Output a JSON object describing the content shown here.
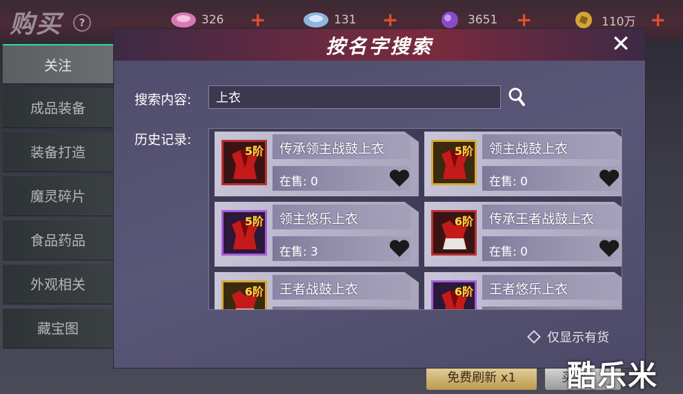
{
  "topbar": {
    "title": "购买",
    "help_glyph": "?",
    "currencies": [
      {
        "icon": "pink-gem-icon",
        "value": "326",
        "color": "#d77ab4"
      },
      {
        "icon": "blue-gem-icon",
        "value": "131",
        "color": "#8fb6e0"
      },
      {
        "icon": "purple-orb-icon",
        "value": "3651",
        "color": "#8a4ac8"
      },
      {
        "icon": "gold-coin-icon",
        "value": "110万",
        "color": "#d4a63a"
      }
    ],
    "plus_glyph": "+"
  },
  "sidebar": {
    "items": [
      {
        "label": "关注",
        "active": true
      },
      {
        "label": "成品装备",
        "active": false
      },
      {
        "label": "装备打造",
        "active": false
      },
      {
        "label": "魔灵碎片",
        "active": false
      },
      {
        "label": "食品药品",
        "active": false
      },
      {
        "label": "外观相关",
        "active": false
      },
      {
        "label": "藏宝图",
        "active": false
      }
    ]
  },
  "bottom": {
    "free_refresh_label": "免费刷新 x1",
    "buy_label": "买到"
  },
  "watermark": "酷乐米",
  "dialog": {
    "title": "按名字搜索",
    "close_glyph": "✕",
    "search_label": "搜索内容:",
    "search_value": "上衣",
    "history_label": "历史记录:",
    "history": [
      {
        "name": "传承领主战鼓上衣",
        "tier": "5阶",
        "stock": "在售: 0",
        "frame": "red"
      },
      {
        "name": "领主战鼓上衣",
        "tier": "5阶",
        "stock": "在售: 0",
        "frame": "gold"
      },
      {
        "name": "领主悠乐上衣",
        "tier": "5阶",
        "stock": "在售: 3",
        "frame": "purple"
      },
      {
        "name": "传承王者战鼓上衣",
        "tier": "6阶",
        "stock": "在售: 0",
        "frame": "red"
      },
      {
        "name": "王者战鼓上衣",
        "tier": "6阶",
        "stock": "",
        "frame": "gold"
      },
      {
        "name": "王者悠乐上衣",
        "tier": "6阶",
        "stock": "",
        "frame": "purple"
      }
    ],
    "in_stock_only_label": "仅显示有货",
    "in_stock_only_checked": false
  },
  "colors": {
    "accent_green": "#3ad4a6",
    "plus_orange": "#e0502a",
    "tier_yellow": "#ffd84a"
  }
}
